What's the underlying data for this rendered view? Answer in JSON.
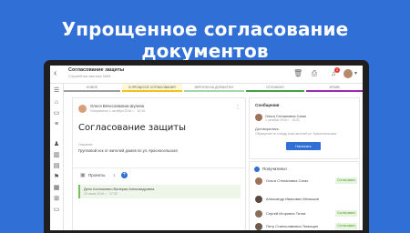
{
  "headline": "Упрощенное согласование документов",
  "topbar": {
    "back_icon": "back-arrow-icon",
    "doc_title": "Согласование защиты",
    "doc_subtitle": "Служебная записка №98",
    "notification_count": "2"
  },
  "sidebar_icons": [
    "menu-icon",
    "home-icon",
    "chat-icon",
    "list-icon",
    "person-icon",
    "building-icon",
    "doc-icon",
    "flag-icon",
    "calendar-icon",
    "grid-icon",
    "folder-icon"
  ],
  "tabs": [
    {
      "label": "Новое",
      "color": "#9e9e9e"
    },
    {
      "label": "В процессе согласования",
      "color": "#f2c21b",
      "active": true
    },
    {
      "label": "Вернули на доработку",
      "color": "#a5d6a7"
    },
    {
      "label": "Отложено",
      "color": "#43a047"
    },
    {
      "label": "Архив",
      "color": "#9c27b0"
    }
  ],
  "main": {
    "author_name": "Олеся Вячеславовна Шулева",
    "author_date": "Отправлено 1 октября 2016 г. · 10:15",
    "title": "Согласование защиты",
    "field_label": "Описание",
    "field_value": "Групповой иск от жителей домов по ул. Красносельская",
    "projects_label": "Проекты",
    "projects_count": "1",
    "project_item_title": "Дело Костюкевич Валерия Александровна",
    "project_item_date": "23 июля 2016 г. · 17:32"
  },
  "message": {
    "title": "Сообщения",
    "from": "Ольга Степановна Сагач",
    "date": "1 октября 2016 г. · 15:31",
    "text": "Договорились",
    "quote": "Обращение по поводу иска жителей ул. Красносельская",
    "button": "Написать"
  },
  "recipients": {
    "title": "Получатели",
    "count": "4",
    "rows": [
      {
        "name": "Ольга Степановна Сагач",
        "status": "Согласовано",
        "status_bg": "#e6f4df",
        "status_fg": "#4c9a2a",
        "avatar": "#a07058"
      },
      {
        "name": "Александр Иванович Меньшов",
        "status": "",
        "status_bg": "#fff",
        "status_fg": "#888",
        "avatar": "#5a4a3e"
      },
      {
        "name": "Сергей Игоревич Титов",
        "status": "Согласовано",
        "status_bg": "#e6f4df",
        "status_fg": "#4c9a2a",
        "avatar": "#8b6e5a"
      },
      {
        "name": "Петр Станиславович Тимощин",
        "status": "Согласовано",
        "status_bg": "#e6f4df",
        "status_fg": "#4c9a2a",
        "avatar": "#6d5b4f"
      }
    ]
  }
}
